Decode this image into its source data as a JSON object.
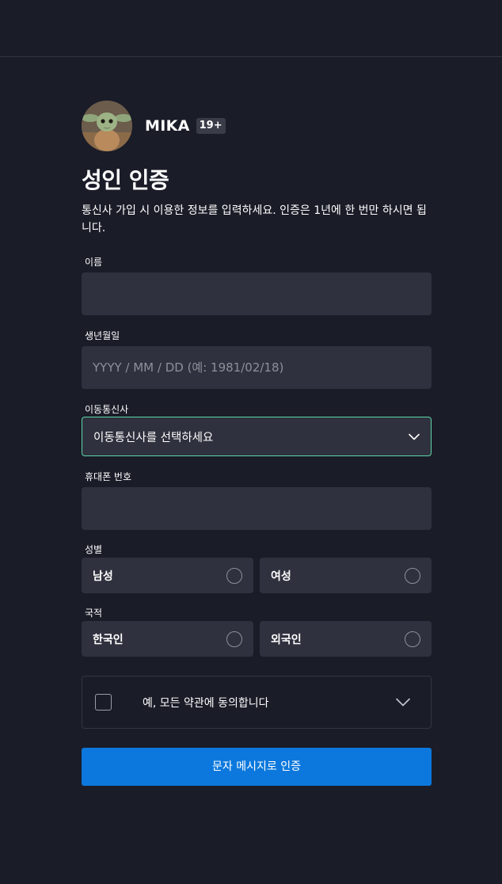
{
  "profile": {
    "name": "MIKA",
    "age_badge": "19+"
  },
  "page": {
    "title": "성인 인증",
    "description": "통신사 가입 시 이용한 정보를 입력하세요. 인증은 1년에 한 번만 하시면 됩니다."
  },
  "form": {
    "name_label": "이름",
    "name_value": "",
    "birth_label": "생년월일",
    "birth_placeholder": "YYYY / MM / DD (예: 1981/02/18)",
    "carrier_label": "이동통신사",
    "carrier_value": "이동통신사를 선택하세요",
    "phone_label": "휴대폰 번호",
    "phone_value": "",
    "gender_label": "성별",
    "gender_options": [
      "남성",
      "여성"
    ],
    "nationality_label": "국적",
    "nationality_options": [
      "한국인",
      "외국인"
    ],
    "agree_label": "예, 모든 약관에 동의합니다",
    "agree_checked": false,
    "submit_label": "문자 메시지로 인증"
  },
  "colors": {
    "background": "#1a1c28",
    "field": "#2f313e",
    "focus_border": "#5dd6a6",
    "primary_button": "#0c78dd"
  },
  "icons": {
    "select_chevron": "chevron-down-icon",
    "agree_chevron": "chevron-down-icon"
  }
}
